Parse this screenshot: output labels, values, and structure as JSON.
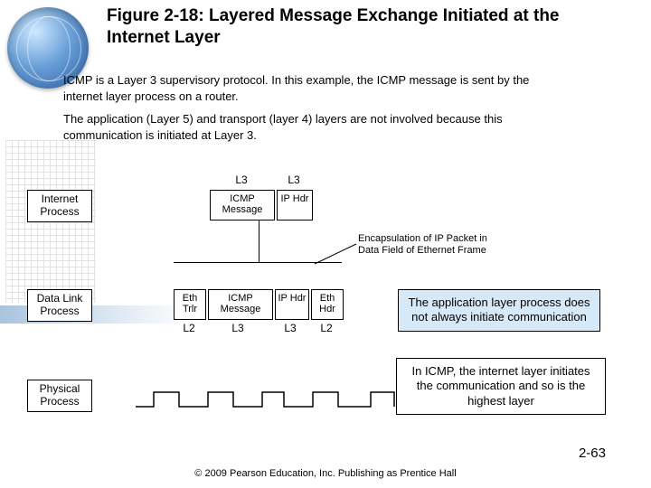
{
  "title": "Figure 2-18: Layered Message Exchange Initiated at the Internet Layer",
  "caption_p1": "ICMP is a Layer 3 supervisory protocol. In this example, the ICMP message is sent by the internet layer process on a router.",
  "caption_p2": "The application (Layer 5) and transport (layer 4) layers are not involved because this communication is initiated at Layer 3.",
  "layers": {
    "internet": "Internet Process",
    "datalink": "Data Link Process",
    "physical": "Physical Process"
  },
  "top_labels": {
    "l3a": "L3",
    "l3b": "L3"
  },
  "l3_pkt": {
    "icmp": "ICMP Message",
    "ip": "IP Hdr"
  },
  "l2_pkt": {
    "eth_trlr": "Eth Trlr",
    "icmp": "ICMP Message",
    "ip": "IP Hdr",
    "eth_hdr": "Eth Hdr"
  },
  "bot_labels": {
    "a": "L2",
    "b": "L3",
    "c": "L3",
    "d": "L2"
  },
  "encaps": "Encapsulation of IP Packet in Data Field of Ethernet Frame",
  "callout1": "The application layer process does not always initiate communication",
  "callout2": "In ICMP, the internet layer initiates the communication and so is the highest layer",
  "pagenum": "2-63",
  "footer": "© 2009 Pearson Education, Inc.  Publishing as Prentice Hall"
}
